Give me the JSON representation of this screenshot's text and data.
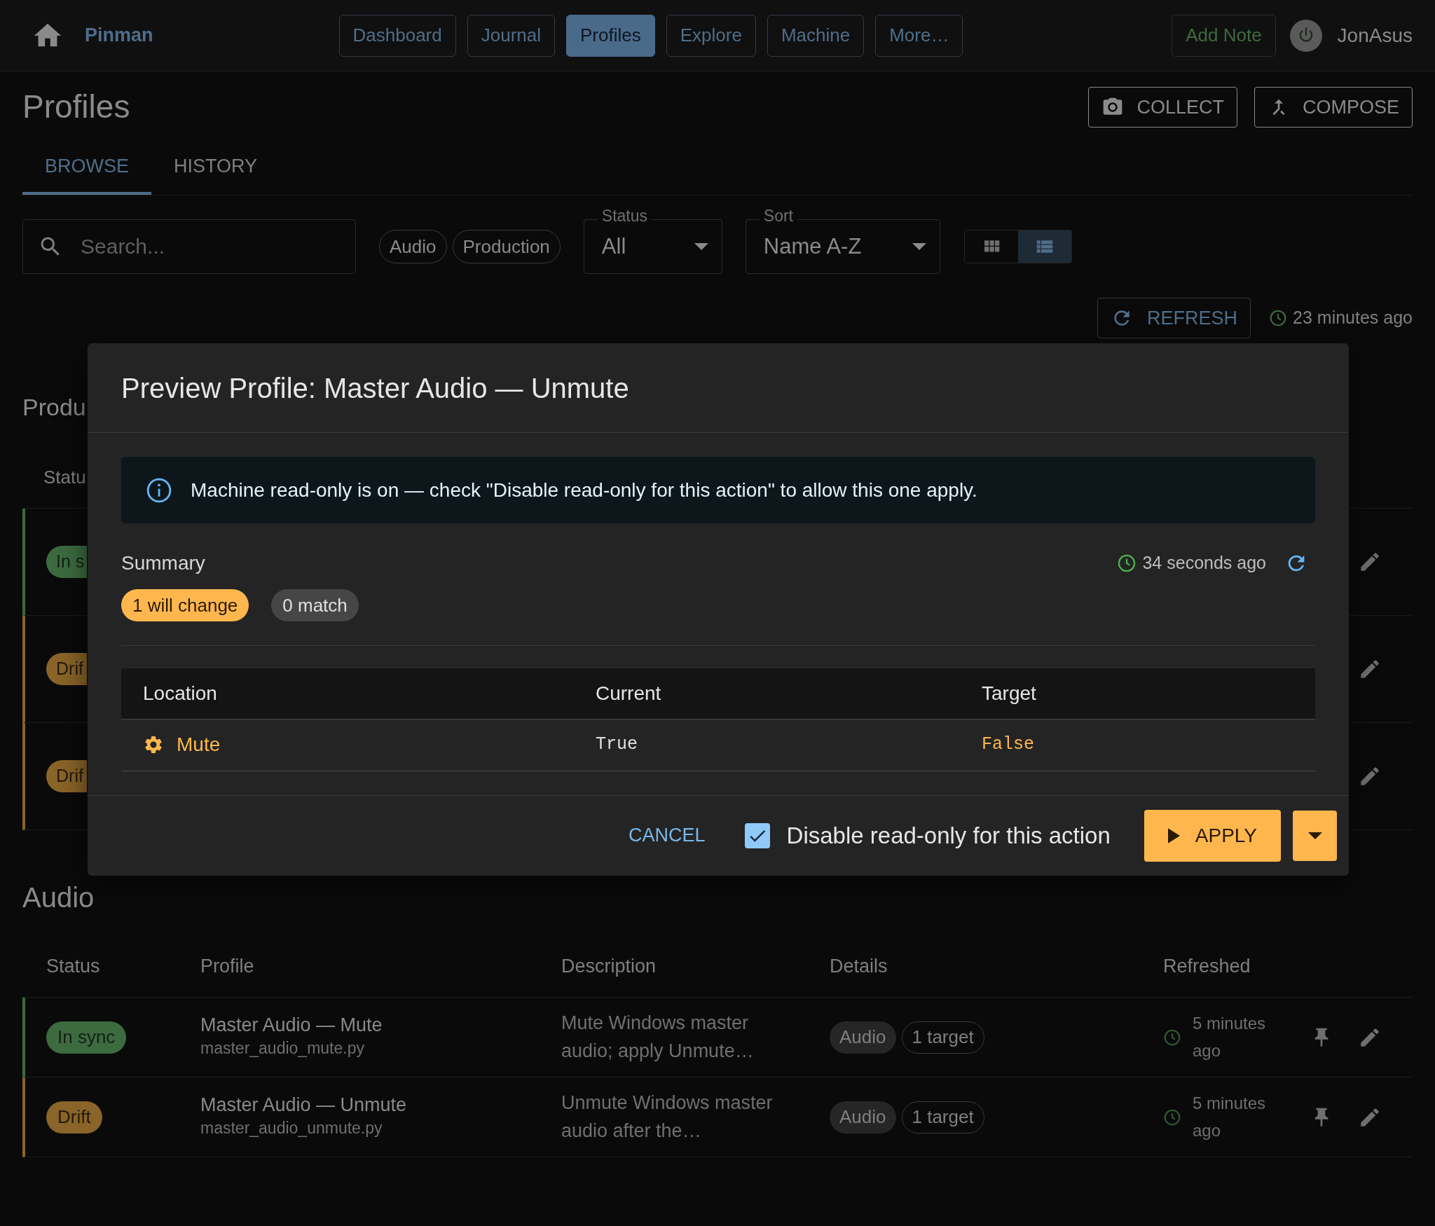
{
  "navbar": {
    "brand": "Pinman",
    "links": [
      {
        "label": "Dashboard",
        "selected": false
      },
      {
        "label": "Journal",
        "selected": false
      },
      {
        "label": "Profiles",
        "selected": true
      },
      {
        "label": "Explore",
        "selected": false
      },
      {
        "label": "Machine",
        "selected": false
      },
      {
        "label": "More…",
        "selected": false
      }
    ],
    "add_note": "Add Note",
    "user": "JonAsus"
  },
  "header": {
    "title": "Profiles",
    "actions": [
      {
        "label": "COLLECT",
        "kind": "camera"
      },
      {
        "label": "COMPOSE",
        "kind": "merge"
      }
    ]
  },
  "tabs": [
    {
      "label": "BROWSE",
      "selected": true
    },
    {
      "label": "HISTORY",
      "selected": false
    }
  ],
  "filters": {
    "search": {
      "placeholder": "Search..."
    },
    "chips": [
      "Audio",
      "Production"
    ],
    "selects": [
      {
        "label": "Status",
        "value": "All"
      },
      {
        "label": "Sort",
        "value": "Name A-Z"
      }
    ],
    "view_modes": [
      {
        "kind": "grid",
        "selected": false
      },
      {
        "kind": "list",
        "selected": true
      }
    ]
  },
  "refresh": {
    "label": "REFRESH",
    "time": "23 minutes ago"
  },
  "groups": [
    {
      "title": "Produ",
      "columns": [
        "Statu"
      ],
      "rows": [
        {
          "status": "In s",
          "kind": "sync"
        },
        {
          "status": "Drif",
          "kind": "drift"
        },
        {
          "status": "Drif",
          "kind": "drift"
        }
      ]
    },
    {
      "title": "Audio",
      "columns": [
        "Status",
        "Profile",
        "Description",
        "Details",
        "Refreshed"
      ],
      "rows": [
        {
          "status": "In sync",
          "kind": "sync",
          "profile": "Master Audio — Mute",
          "file": "master_audio_mute.py",
          "description": "Mute Windows master audio; apply Unmute…",
          "category": "Audio",
          "targets": "1 target",
          "refreshed": "5 minutes ago"
        },
        {
          "status": "Drift",
          "kind": "drift",
          "profile": "Master Audio — Unmute",
          "file": "master_audio_unmute.py",
          "description": "Unmute Windows master audio after the…",
          "category": "Audio",
          "targets": "1 target",
          "refreshed": "5 minutes ago"
        }
      ]
    }
  ],
  "dialog": {
    "title": "Preview Profile: Master Audio — Unmute",
    "alert": "Machine read-only is on — check \"Disable read-only for this action\" to allow this one apply.",
    "summary": {
      "label": "Summary",
      "time": "34 seconds ago",
      "chips": [
        {
          "label": "1 will change",
          "kind": "change"
        },
        {
          "label": "0 match",
          "kind": "match"
        }
      ]
    },
    "table": {
      "columns": [
        "Location",
        "Current",
        "Target"
      ],
      "rows": [
        {
          "location": "Mute",
          "current": "True",
          "target": "False",
          "changed": true
        }
      ]
    },
    "footer": {
      "cancel": "CANCEL",
      "checkbox": {
        "label": "Disable read-only for this action",
        "checked": true
      },
      "apply": "APPLY"
    }
  }
}
